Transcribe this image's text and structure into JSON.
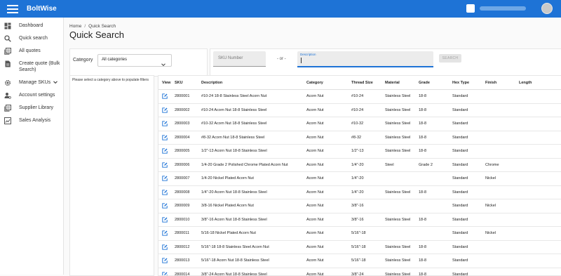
{
  "app": {
    "brand": "BoltWise"
  },
  "sidebar": {
    "items": [
      {
        "label": "Dashboard",
        "icon": "dashboard-icon"
      },
      {
        "label": "Quick search",
        "icon": "search-icon"
      },
      {
        "label": "All quotes",
        "icon": "library-icon"
      },
      {
        "label": "Create quote (Bulk Search)",
        "icon": "document-icon"
      },
      {
        "label": "Manage SKUs",
        "icon": "gear-icon",
        "expandable": true
      },
      {
        "label": "Account settings",
        "icon": "account-settings-icon"
      },
      {
        "label": "Supplier Library",
        "icon": "library-icon"
      },
      {
        "label": "Sales Analysis",
        "icon": "chart-icon"
      }
    ]
  },
  "breadcrumb": {
    "home": "Home",
    "separator": "/",
    "current": "Quick Search"
  },
  "page": {
    "title": "Quick Search"
  },
  "filters": {
    "category_label": "Category",
    "category_value": "All categories",
    "hint": "Please select a category above to populate filters"
  },
  "search": {
    "sku_placeholder": "SKU Number",
    "or_label": "- or -",
    "description_label": "Description",
    "button_label": "SEARCH"
  },
  "table": {
    "columns": [
      "View",
      "SKU",
      "Description",
      "Category",
      "Thread Size",
      "Material",
      "Grade",
      "Hex Type",
      "Finish",
      "Length"
    ],
    "rows": [
      [
        "2800001",
        "#10-24 18-8 Stainless Steel Acorn Nut",
        "Acorn Nut",
        "#10-24",
        "Stainless Steel",
        "18-8",
        "Standard",
        "",
        ""
      ],
      [
        "2800002",
        "#10-24 Acorn Nut 18-8 Stainless Steel",
        "Acorn Nut",
        "#10-24",
        "Stainless Steel",
        "18-8",
        "Standard",
        "",
        ""
      ],
      [
        "2800003",
        "#10-32 Acorn Nut 18-8 Stainless Steel",
        "Acorn Nut",
        "#10-32",
        "Stainless Steel",
        "18-8",
        "Standard",
        "",
        ""
      ],
      [
        "2800004",
        "#8-32 Acorn Nut 18-8 Stainless Steel",
        "Acorn Nut",
        "#8-32",
        "Stainless Steel",
        "18-8",
        "Standard",
        "",
        ""
      ],
      [
        "2800005",
        "1/2\"-13 Acorn Nut 18-8 Stainless Steel",
        "Acorn Nut",
        "1/2\"-13",
        "Stainless Steel",
        "18-8",
        "Standard",
        "",
        ""
      ],
      [
        "2800006",
        "1/4-20 Grade 2 Polished Chrome Plated Acorn Nut",
        "Acorn Nut",
        "1/4\"-20",
        "Steel",
        "Grade 2",
        "Standard",
        "Chrome",
        ""
      ],
      [
        "2800007",
        "1/4-20 Nickel Plated Acorn Nut",
        "Acorn Nut",
        "1/4\"-20",
        "",
        "",
        "Standard",
        "Nickel",
        ""
      ],
      [
        "2800008",
        "1/4\"-20 Acorn Nut 18-8 Stainless Steel",
        "Acorn Nut",
        "1/4\"-20",
        "Stainless Steel",
        "18-8",
        "Standard",
        "",
        ""
      ],
      [
        "2800009",
        "3/8-16 Nickel Plated Acorn Nut",
        "Acorn Nut",
        "3/8\"-16",
        "",
        "",
        "Standard",
        "Nickel",
        ""
      ],
      [
        "2800010",
        "3/8\"-16 Acorn Nut 18-8 Stainless Steel",
        "Acorn Nut",
        "3/8\"-16",
        "Stainless Steel",
        "18-8",
        "Standard",
        "",
        ""
      ],
      [
        "2800011",
        "5/16-18 Nickel Plated Acorn Nut",
        "Acorn Nut",
        "5/16\"-18",
        "",
        "",
        "Standard",
        "Nickel",
        ""
      ],
      [
        "2800012",
        "5/16\"-18 18-8 Stainless Steel Acorn Nut",
        "Acorn Nut",
        "5/16\"-18",
        "Stainless Steel",
        "18-8",
        "Standard",
        "",
        ""
      ],
      [
        "2800013",
        "5/16\"-18 Acorn Nut 18-8 Stainless Steel",
        "Acorn Nut",
        "5/16\"-18",
        "Stainless Steel",
        "18-8",
        "Standard",
        "",
        ""
      ],
      [
        "2800014",
        "3/8\"-24 Acorn Nut 18-8 Stainless Steel",
        "Acorn Nut",
        "3/8\"-24",
        "Stainless Steel",
        "18-8",
        "Standard",
        "",
        ""
      ]
    ]
  },
  "colors": {
    "appbar": "#1e73d6",
    "accent": "#1e73d6"
  }
}
